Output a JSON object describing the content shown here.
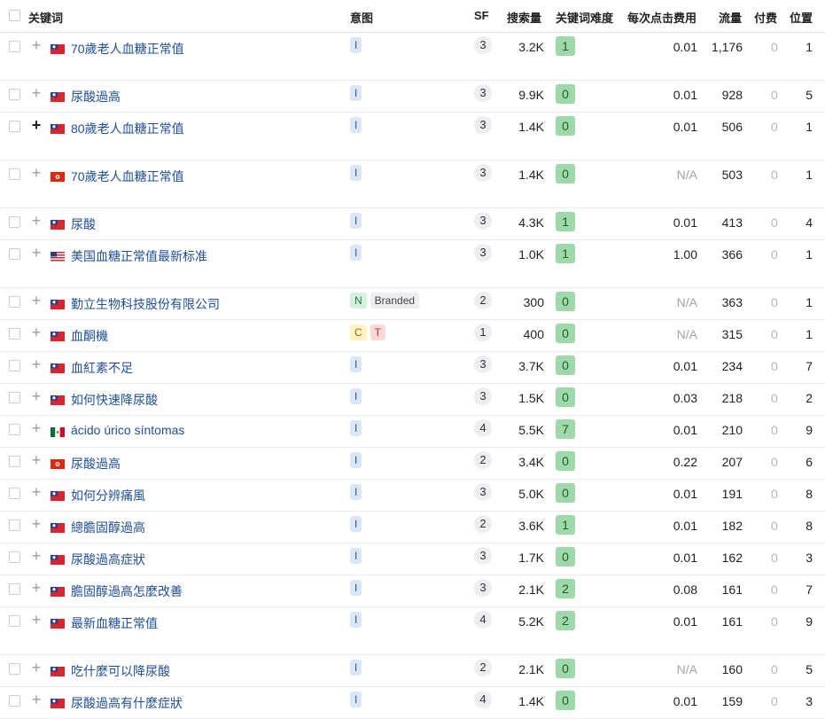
{
  "header": {
    "keyword": "关键词",
    "intent": "意图",
    "sf": "SF",
    "volume": "搜索量",
    "kd": "关键词难度",
    "cpc": "每次点击费用",
    "traffic": "流量",
    "paid": "付费",
    "position": "位置"
  },
  "rows": [
    {
      "flag": "tw",
      "keyword": "70歲老人血糖正常值",
      "intents": [
        "I"
      ],
      "sf": "3",
      "volume": "3.2K",
      "kd": "1",
      "cpc": "0.01",
      "traffic": "1,176",
      "paid": "0",
      "position": "1"
    },
    {
      "flag": "tw",
      "keyword": "尿酸過高",
      "intents": [
        "I"
      ],
      "sf": "3",
      "volume": "9.9K",
      "kd": "0",
      "cpc": "0.01",
      "traffic": "928",
      "paid": "0",
      "position": "5"
    },
    {
      "flag": "tw",
      "keyword": "80歲老人血糖正常值",
      "intents": [
        "I"
      ],
      "sf": "3",
      "volume": "1.4K",
      "kd": "0",
      "cpc": "0.01",
      "traffic": "506",
      "paid": "0",
      "position": "1",
      "plus_dark": true
    },
    {
      "flag": "hk",
      "keyword": "70歲老人血糖正常值",
      "intents": [
        "I"
      ],
      "sf": "3",
      "volume": "1.4K",
      "kd": "0",
      "cpc": "N/A",
      "traffic": "503",
      "paid": "0",
      "position": "1"
    },
    {
      "flag": "tw",
      "keyword": "尿酸",
      "intents": [
        "I"
      ],
      "sf": "3",
      "volume": "4.3K",
      "kd": "1",
      "cpc": "0.01",
      "traffic": "413",
      "paid": "0",
      "position": "4"
    },
    {
      "flag": "us",
      "keyword": "美国血糖正常值最新标准",
      "intents": [
        "I"
      ],
      "sf": "3",
      "volume": "1.0K",
      "kd": "1",
      "cpc": "1.00",
      "traffic": "366",
      "paid": "0",
      "position": "1"
    },
    {
      "flag": "tw",
      "keyword": "勤立生物科技股份有限公司",
      "intents": [
        "N",
        "Branded"
      ],
      "sf": "2",
      "volume": "300",
      "kd": "0",
      "cpc": "N/A",
      "traffic": "363",
      "paid": "0",
      "position": "1"
    },
    {
      "flag": "tw",
      "keyword": "血酮機",
      "intents": [
        "C",
        "T"
      ],
      "sf": "1",
      "volume": "400",
      "kd": "0",
      "cpc": "N/A",
      "traffic": "315",
      "paid": "0",
      "position": "1"
    },
    {
      "flag": "tw",
      "keyword": "血紅素不足",
      "intents": [
        "I"
      ],
      "sf": "3",
      "volume": "3.7K",
      "kd": "0",
      "cpc": "0.01",
      "traffic": "234",
      "paid": "0",
      "position": "7"
    },
    {
      "flag": "tw",
      "keyword": "如何快速降尿酸",
      "intents": [
        "I"
      ],
      "sf": "3",
      "volume": "1.5K",
      "kd": "0",
      "cpc": "0.03",
      "traffic": "218",
      "paid": "0",
      "position": "2"
    },
    {
      "flag": "mx",
      "keyword": "ácido úrico síntomas",
      "intents": [
        "I"
      ],
      "sf": "4",
      "volume": "5.5K",
      "kd": "7",
      "cpc": "0.01",
      "traffic": "210",
      "paid": "0",
      "position": "9"
    },
    {
      "flag": "hk",
      "keyword": "尿酸過高",
      "intents": [
        "I"
      ],
      "sf": "2",
      "volume": "3.4K",
      "kd": "0",
      "cpc": "0.22",
      "traffic": "207",
      "paid": "0",
      "position": "6"
    },
    {
      "flag": "tw",
      "keyword": "如何分辨痛風",
      "intents": [
        "I"
      ],
      "sf": "3",
      "volume": "5.0K",
      "kd": "0",
      "cpc": "0.01",
      "traffic": "191",
      "paid": "0",
      "position": "8"
    },
    {
      "flag": "tw",
      "keyword": "總膽固醇過高",
      "intents": [
        "I"
      ],
      "sf": "2",
      "volume": "3.6K",
      "kd": "1",
      "cpc": "0.01",
      "traffic": "182",
      "paid": "0",
      "position": "8"
    },
    {
      "flag": "tw",
      "keyword": "尿酸過高症狀",
      "intents": [
        "I"
      ],
      "sf": "3",
      "volume": "1.7K",
      "kd": "0",
      "cpc": "0.01",
      "traffic": "162",
      "paid": "0",
      "position": "3"
    },
    {
      "flag": "tw",
      "keyword": "膽固醇過高怎麼改善",
      "intents": [
        "I"
      ],
      "sf": "3",
      "volume": "2.1K",
      "kd": "2",
      "cpc": "0.08",
      "traffic": "161",
      "paid": "0",
      "position": "7"
    },
    {
      "flag": "tw",
      "keyword": "最新血糖正常值",
      "intents": [
        "I"
      ],
      "sf": "4",
      "volume": "5.2K",
      "kd": "2",
      "cpc": "0.01",
      "traffic": "161",
      "paid": "0",
      "position": "9"
    },
    {
      "flag": "tw",
      "keyword": "吃什麼可以降尿酸",
      "intents": [
        "I"
      ],
      "sf": "2",
      "volume": "2.1K",
      "kd": "0",
      "cpc": "N/A",
      "traffic": "160",
      "paid": "0",
      "position": "5"
    },
    {
      "flag": "tw",
      "keyword": "尿酸過高有什麼症狀",
      "intents": [
        "I"
      ],
      "sf": "4",
      "volume": "1.4K",
      "kd": "0",
      "cpc": "0.01",
      "traffic": "159",
      "paid": "0",
      "position": "3"
    }
  ]
}
